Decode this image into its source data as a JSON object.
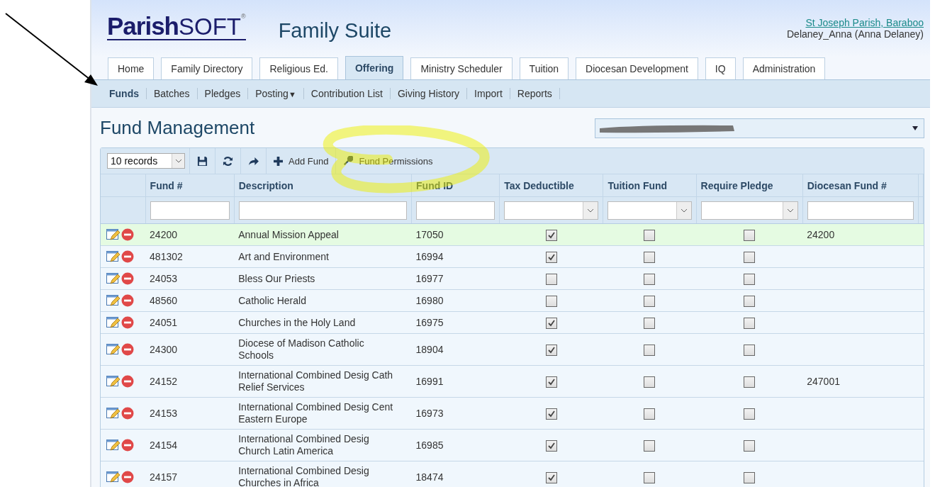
{
  "header": {
    "logo": {
      "name": "Parish",
      "suffix": "SOFT",
      "mark": "®"
    },
    "suite": "Family Suite",
    "parish_link": "St Joseph Parish, Baraboo",
    "user": "Delaney_Anna (Anna Delaney)"
  },
  "tabs": [
    {
      "label": "Home",
      "selected": false
    },
    {
      "label": "Family Directory",
      "selected": false
    },
    {
      "label": "Religious Ed.",
      "selected": false
    },
    {
      "label": "Offering",
      "selected": true
    },
    {
      "label": "Ministry Scheduler",
      "selected": false
    },
    {
      "label": "Tuition",
      "selected": false
    },
    {
      "label": "Diocesan Development",
      "selected": false
    },
    {
      "label": "IQ",
      "selected": false
    },
    {
      "label": "Administration",
      "selected": false
    }
  ],
  "subnav": [
    {
      "label": "Funds",
      "selected": true
    },
    {
      "label": "Batches",
      "selected": false
    },
    {
      "label": "Pledges",
      "selected": false
    },
    {
      "label": "Posting",
      "caret": "▼",
      "selected": false
    },
    {
      "label": "Contribution List",
      "selected": false
    },
    {
      "label": "Giving History",
      "selected": false
    },
    {
      "label": "Import",
      "selected": false
    },
    {
      "label": "Reports",
      "selected": false
    }
  ],
  "page_title": "Fund Management",
  "toolbar": {
    "page_size": "10 records",
    "add_label": "Add Fund",
    "permissions_label": "Fund Permissions"
  },
  "table": {
    "columns": [
      {
        "label": "Fund #",
        "kind": "text"
      },
      {
        "label": "Description",
        "kind": "text"
      },
      {
        "label": "Fund ID",
        "kind": "text"
      },
      {
        "label": "Tax Deductible",
        "kind": "select"
      },
      {
        "label": "Tuition Fund",
        "kind": "select"
      },
      {
        "label": "Require Pledge",
        "kind": "select"
      },
      {
        "label": "Diocesan Fund #",
        "kind": "text"
      }
    ],
    "rows": [
      {
        "fund_no": "24200",
        "description": "Annual Mission Appeal",
        "fund_id": "17050",
        "tax_deductible": true,
        "tuition_fund": false,
        "require_pledge": false,
        "diocesan_fund_no": "24200",
        "selected": true
      },
      {
        "fund_no": "481302",
        "description": "Art and Environment",
        "fund_id": "16994",
        "tax_deductible": true,
        "tuition_fund": false,
        "require_pledge": false,
        "selected": false
      },
      {
        "fund_no": "24053",
        "description": "Bless Our Priests",
        "fund_id": "16977",
        "tax_deductible": false,
        "tuition_fund": false,
        "require_pledge": false,
        "selected": false
      },
      {
        "fund_no": "48560",
        "description": "Catholic Herald",
        "fund_id": "16980",
        "tax_deductible": false,
        "tuition_fund": false,
        "require_pledge": false,
        "selected": false
      },
      {
        "fund_no": "24051",
        "description": "Churches in the Holy Land",
        "fund_id": "16975",
        "tax_deductible": true,
        "tuition_fund": false,
        "require_pledge": false,
        "selected": false
      },
      {
        "fund_no": "24300",
        "description": "Diocese of Madison Catholic Schools",
        "fund_id": "18904",
        "tax_deductible": true,
        "tuition_fund": false,
        "require_pledge": false,
        "selected": false
      },
      {
        "fund_no": "24152",
        "description": "International Combined Desig Cath Relief Services",
        "fund_id": "16991",
        "tax_deductible": true,
        "tuition_fund": false,
        "require_pledge": false,
        "diocesan_fund_no": "247001",
        "selected": false
      },
      {
        "fund_no": "24153",
        "description": "International Combined Desig Cent Eastern Europe",
        "fund_id": "16973",
        "tax_deductible": true,
        "tuition_fund": false,
        "require_pledge": false,
        "selected": false
      },
      {
        "fund_no": "24154",
        "description": "International Combined Desig Church Latin America",
        "fund_id": "16985",
        "tax_deductible": true,
        "tuition_fund": false,
        "require_pledge": false,
        "selected": false
      },
      {
        "fund_no": "24157",
        "description": "International Combined Desig Churches in Africa",
        "fund_id": "18474",
        "tax_deductible": true,
        "tuition_fund": false,
        "require_pledge": false,
        "selected": false
      }
    ]
  }
}
